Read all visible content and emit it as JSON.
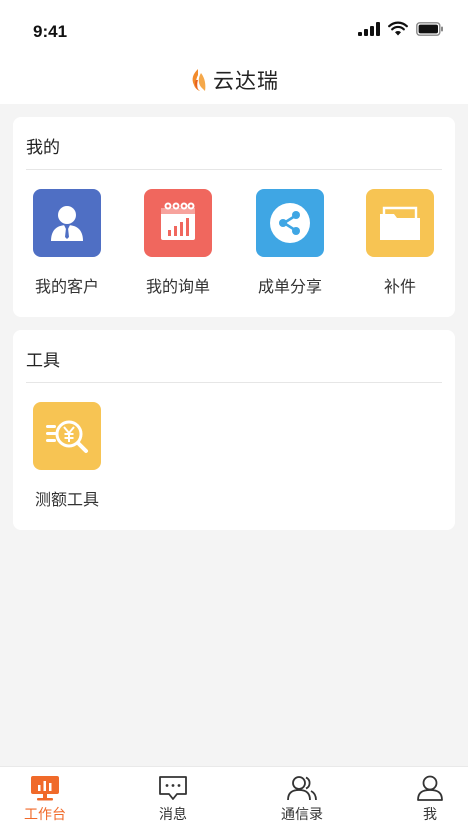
{
  "status": {
    "time": "9:41"
  },
  "header": {
    "app_name": "云达瑞"
  },
  "sections": {
    "mine": {
      "title": "我的",
      "items": [
        {
          "label": "我的客户",
          "icon": "customer-icon",
          "color": "#4f6fc4"
        },
        {
          "label": "我的询单",
          "icon": "inquiry-chart-icon",
          "color": "#f0675e"
        },
        {
          "label": "成单分享",
          "icon": "share-icon",
          "color": "#3fa6e4"
        },
        {
          "label": "补件",
          "icon": "folder-icon",
          "color": "#f7c453"
        }
      ]
    },
    "tools": {
      "title": "工具",
      "items": [
        {
          "label": "测额工具",
          "icon": "credit-check-icon",
          "color": "#f7c453"
        }
      ]
    }
  },
  "tabbar": {
    "items": [
      {
        "label": "工作台",
        "icon": "workbench-icon",
        "active": true
      },
      {
        "label": "消息",
        "icon": "message-icon",
        "active": false
      },
      {
        "label": "通信录",
        "icon": "contacts-icon",
        "active": false
      },
      {
        "label": "我",
        "icon": "profile-icon",
        "active": false
      }
    ],
    "active_color": "#f06a2a"
  }
}
